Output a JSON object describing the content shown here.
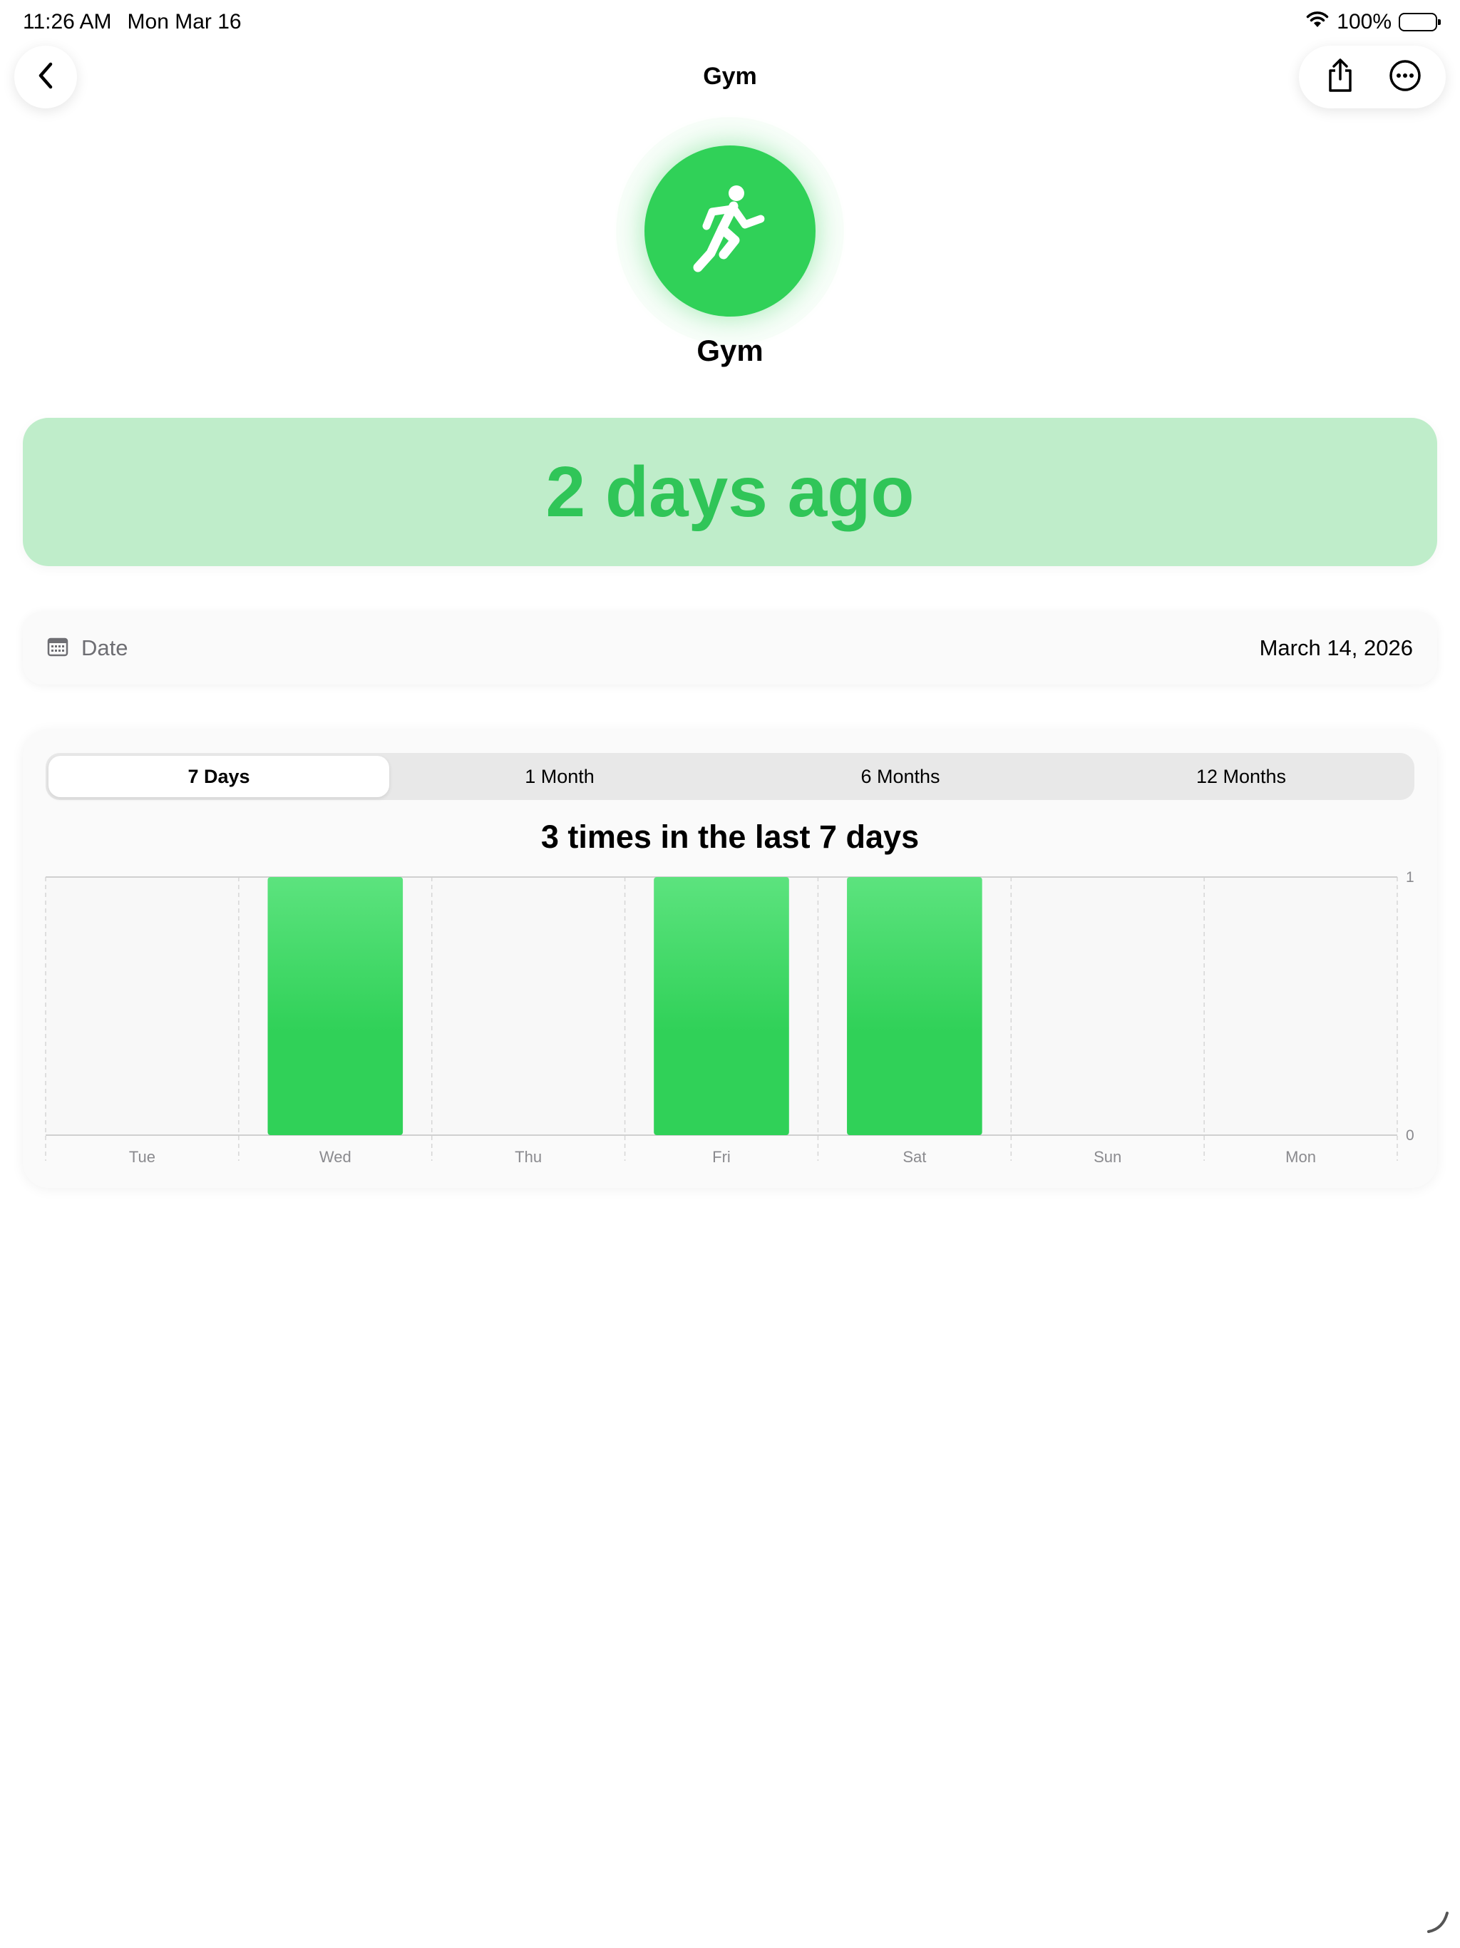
{
  "status": {
    "time": "11:26 AM",
    "date": "Mon Mar 16",
    "battery": "100%",
    "battery_level": 1.0
  },
  "nav": {
    "title": "Gym",
    "back_icon": "chevron-left-icon",
    "share_icon": "share-icon",
    "more_icon": "ellipsis-circle-icon"
  },
  "hero": {
    "icon": "running-figure-icon",
    "title": "Gym",
    "accent": "#30d158"
  },
  "summary": {
    "text": "2 days ago",
    "background": "#bfedca",
    "text_color": "#30c558"
  },
  "date_row": {
    "icon": "calendar-icon",
    "label": "Date",
    "value": "March 14, 2026"
  },
  "range_tabs": [
    {
      "label": "7 Days",
      "active": true
    },
    {
      "label": "1 Month",
      "active": false
    },
    {
      "label": "6 Months",
      "active": false
    },
    {
      "label": "12 Months",
      "active": false
    }
  ],
  "chart_title": "3 times in the last 7 days",
  "chart_data": {
    "type": "bar",
    "categories": [
      "Tue",
      "Wed",
      "Thu",
      "Fri",
      "Sat",
      "Sun",
      "Mon"
    ],
    "values": [
      0,
      1,
      0,
      1,
      1,
      0,
      0
    ],
    "ylim": [
      0,
      1
    ],
    "yticks": [
      "0",
      "1"
    ],
    "grid": true,
    "bar_color": "#30d158"
  }
}
